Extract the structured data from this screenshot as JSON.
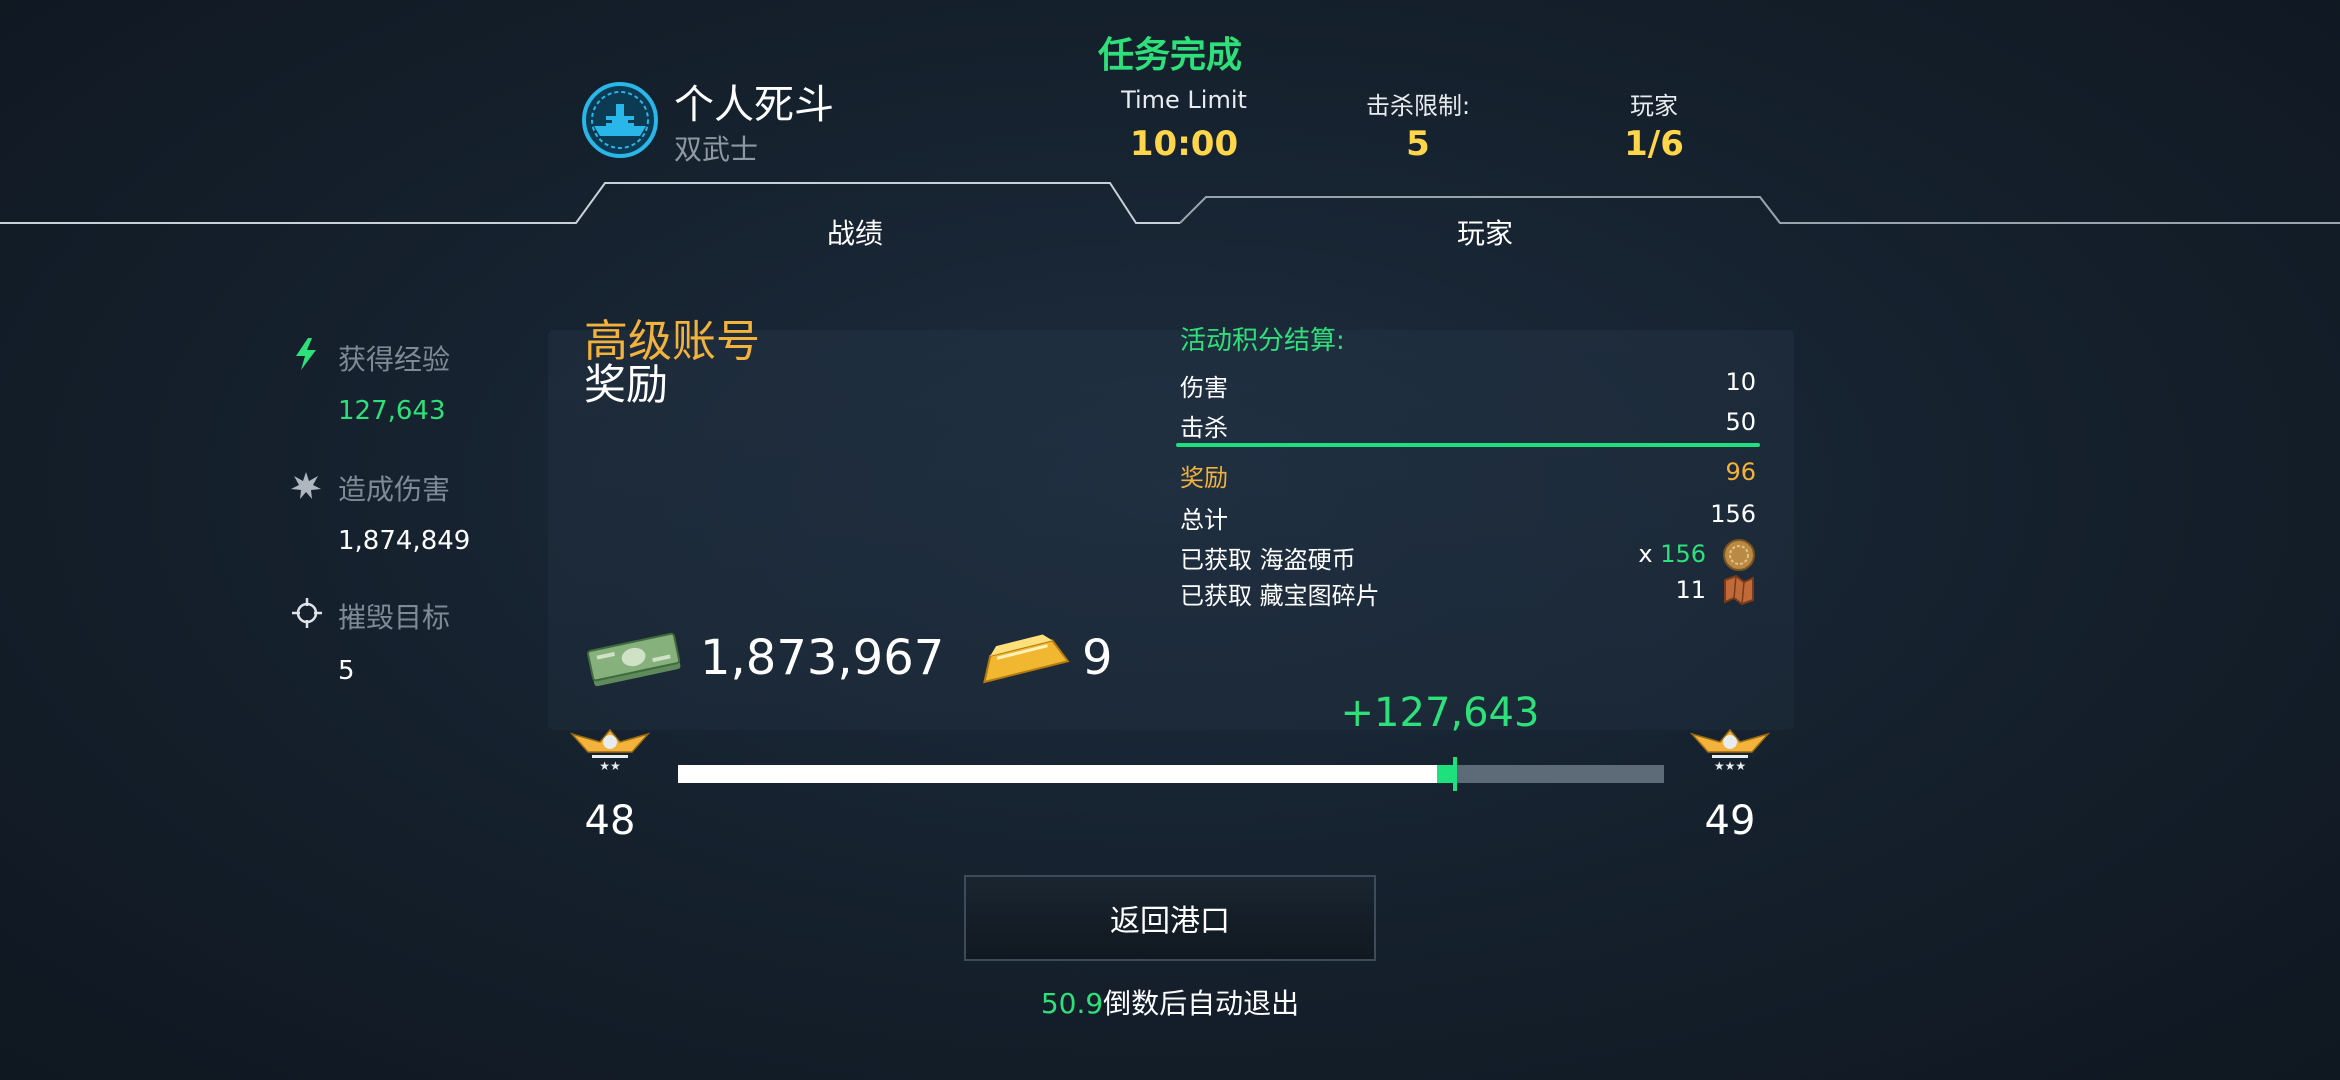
{
  "header": {
    "mission_status": "任务完成",
    "mode_name": "个人死斗",
    "mode_sub": "双武士",
    "stats": [
      {
        "label": "Time Limit",
        "value": "10:00"
      },
      {
        "label": "击杀限制:",
        "value": "5"
      },
      {
        "label": "玩家",
        "value": "1/6"
      }
    ]
  },
  "tabs": [
    {
      "label": "战绩",
      "active": true
    },
    {
      "label": "玩家",
      "active": false
    }
  ],
  "left_stats": [
    {
      "icon": "lightning-icon",
      "label": "获得经验",
      "value": "127,643",
      "value_color": "#2ee07a"
    },
    {
      "icon": "explosion-icon",
      "label": "造成伤害",
      "value": "1,874,849",
      "value_color": "#ffffff"
    },
    {
      "icon": "crosshair-icon",
      "label": "摧毁目标",
      "value": "5",
      "value_color": "#ffffff"
    }
  ],
  "premium": {
    "title": "高级账号",
    "subtitle": "奖励"
  },
  "summary": {
    "title": "活动积分结算:",
    "rows": [
      {
        "label": "伤害",
        "value": "10"
      },
      {
        "label": "击杀",
        "value": "50"
      },
      {
        "label": "奖励",
        "value": "96"
      },
      {
        "label": "总计",
        "value": "156"
      }
    ],
    "obtained": [
      {
        "label": "已获取 海盗硬币",
        "prefix": "x",
        "value": "156",
        "icon": "pirate-coin-icon"
      },
      {
        "label": "已获取 藏宝图碎片",
        "prefix": "",
        "value": "11",
        "icon": "treasure-map-icon"
      }
    ]
  },
  "rewards": {
    "cash": "1,873,967",
    "gold": "9"
  },
  "progress": {
    "xp_gain": "+127,643",
    "current_level": "48",
    "next_level": "49",
    "fill_fraction": 0.77,
    "gain_fraction": 0.018
  },
  "actions": {
    "return_label": "返回港口",
    "countdown_value": "50.9",
    "countdown_text": "倒数后自动退出"
  },
  "colors": {
    "accent_green": "#2ee07a",
    "gold_text": "#ffd54a",
    "premium_orange": "#f3b23b"
  }
}
